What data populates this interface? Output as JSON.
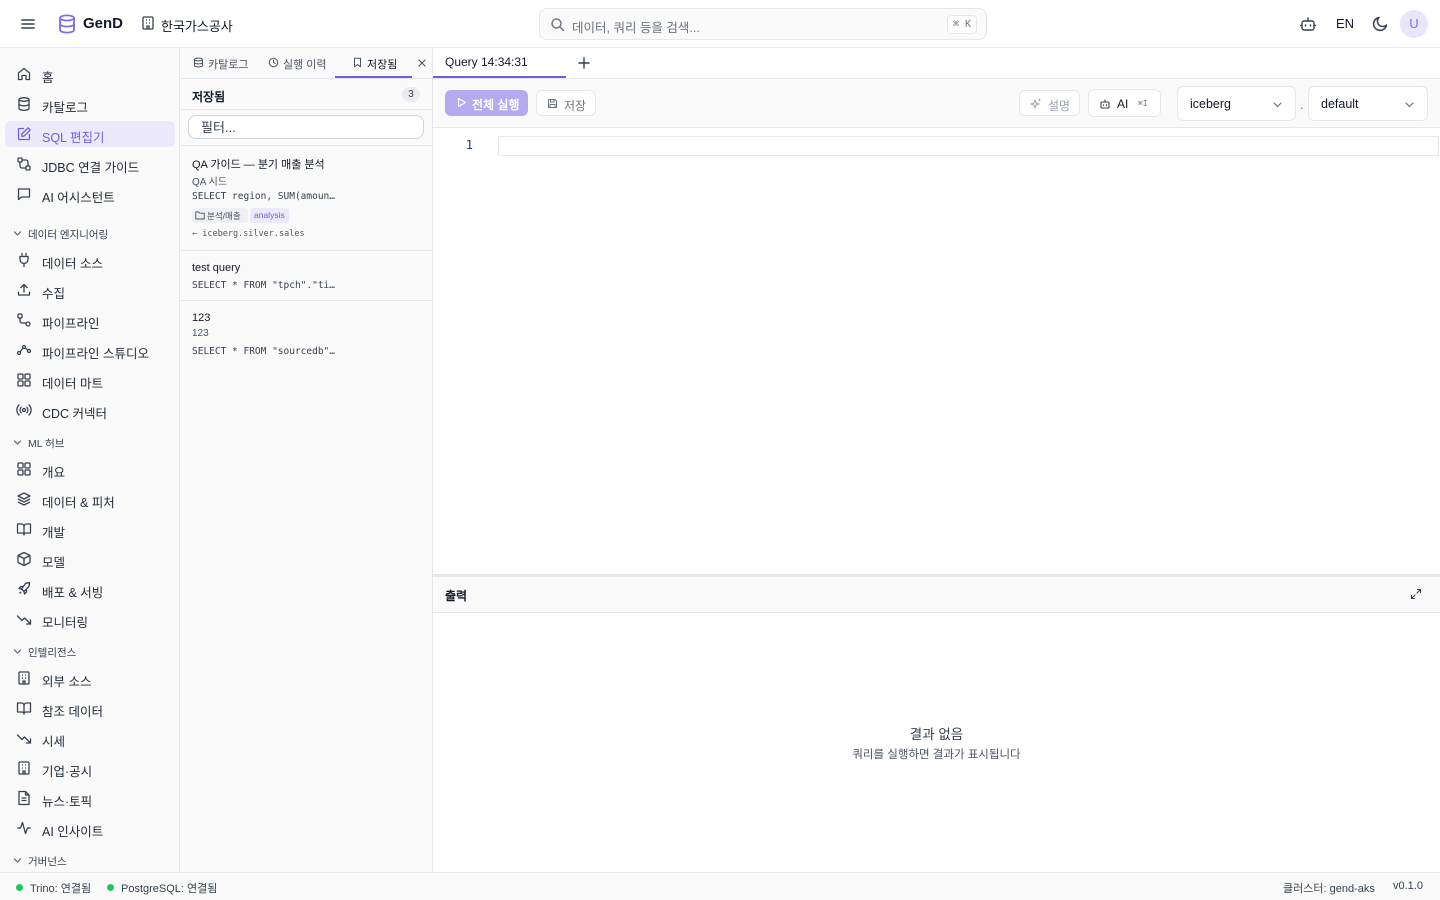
{
  "topbar": {
    "brand": "GenD",
    "org": "한국가스공사",
    "search_placeholder": "데이터, 쿼리 등을 검색...",
    "search_shortcut": "⌘ K",
    "lang": "EN",
    "avatar_initial": "U"
  },
  "sidebar": {
    "top_items": [
      {
        "label": "홈",
        "icon": "home-icon"
      },
      {
        "label": "카탈로그",
        "icon": "database-icon"
      },
      {
        "label": "SQL 편집기",
        "icon": "edit-icon",
        "active": true
      },
      {
        "label": "JDBC 연결 가이드",
        "icon": "cable-icon"
      },
      {
        "label": "AI 어시스턴트",
        "icon": "message-icon"
      }
    ],
    "sections": [
      {
        "title": "데이터 엔지니어링",
        "items": [
          {
            "label": "데이터 소스",
            "icon": "plug-icon"
          },
          {
            "label": "수집",
            "icon": "upload-icon"
          },
          {
            "label": "파이프라인",
            "icon": "route-icon"
          },
          {
            "label": "파이프라인 스튜디오",
            "icon": "workflow-icon"
          },
          {
            "label": "데이터 마트",
            "icon": "grid-icon"
          },
          {
            "label": "CDC 커넥터",
            "icon": "radio-icon"
          }
        ]
      },
      {
        "title": "ML 허브",
        "items": [
          {
            "label": "개요",
            "icon": "grid-icon"
          },
          {
            "label": "데이터 & 피처",
            "icon": "layers-icon"
          },
          {
            "label": "개발",
            "icon": "book-icon"
          },
          {
            "label": "모델",
            "icon": "box-icon"
          },
          {
            "label": "배포 & 서빙",
            "icon": "rocket-icon"
          },
          {
            "label": "모니터링",
            "icon": "trend-down-icon"
          }
        ]
      },
      {
        "title": "인텔리전스",
        "items": [
          {
            "label": "외부 소스",
            "icon": "building-icon"
          },
          {
            "label": "참조 데이터",
            "icon": "book-icon"
          },
          {
            "label": "시세",
            "icon": "trend-down-icon"
          },
          {
            "label": "기업·공시",
            "icon": "building-icon"
          },
          {
            "label": "뉴스·토픽",
            "icon": "document-icon"
          },
          {
            "label": "AI 인사이트",
            "icon": "activity-icon"
          }
        ]
      },
      {
        "title": "거버넌스",
        "items": []
      }
    ]
  },
  "panel": {
    "tabs": [
      {
        "label": "카탈로그",
        "icon": "database-icon"
      },
      {
        "label": "실행 이력",
        "icon": "clock-icon"
      },
      {
        "label": "저장됨",
        "icon": "bookmark-icon",
        "active": true
      }
    ],
    "header_title": "저장됨",
    "count": "3",
    "filter_placeholder": "필터...",
    "saved": [
      {
        "title": "QA 가이드 — 분기 매출 분석",
        "desc": "QA 시드",
        "sql": "SELECT region, SUM(amoun…",
        "folder": "분석/매출",
        "tag": "analysis",
        "lineage": "← iceberg.silver.sales"
      },
      {
        "title": "test query",
        "desc": "",
        "sql": "SELECT * FROM \"tpch\".\"ti…"
      },
      {
        "title": "123",
        "desc": "123",
        "sql": "SELECT * FROM \"sourcedb\"…"
      }
    ]
  },
  "editor": {
    "tab_label": "Query 14:34:31",
    "run_label": "전체 실행",
    "save_label": "저장",
    "explain_label": "설명",
    "ai_label": "AI",
    "ai_shortcut": "⌘I",
    "catalog": "iceberg",
    "schema_sep": ".",
    "schema": "default",
    "line_number": "1",
    "output_title": "출력",
    "empty_title": "결과 없음",
    "empty_sub": "쿼리를 실행하면 결과가 표시됩니다"
  },
  "status": {
    "trino": "Trino: 연결됨",
    "postgres": "PostgreSQL: 연결됨",
    "cluster": "클러스터: gend-aks",
    "version": "v0.1.0",
    "connected_color": "#22c55e"
  },
  "colors": {
    "accent": "#6d5fe0",
    "accent_light": "#ece9fb",
    "run_button": "#b3aaf0"
  }
}
